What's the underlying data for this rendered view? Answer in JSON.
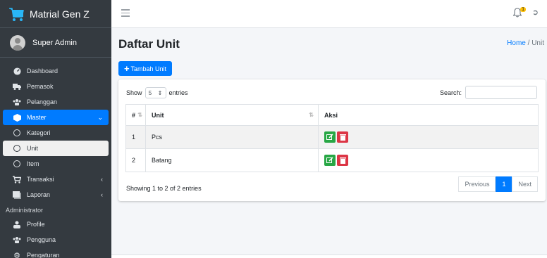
{
  "brand": {
    "name": "Matrial Gen Z"
  },
  "user": {
    "name": "Super Admin"
  },
  "sidebar": {
    "items": [
      {
        "label": "Dashboard",
        "icon": "dashboard-icon"
      },
      {
        "label": "Pemasok",
        "icon": "truck-icon"
      },
      {
        "label": "Pelanggan",
        "icon": "users-icon"
      },
      {
        "label": "Master",
        "icon": "cube-icon",
        "active": true
      },
      {
        "label": "Kategori",
        "icon": "circle-icon"
      },
      {
        "label": "Unit",
        "icon": "circle-icon",
        "selected": true
      },
      {
        "label": "Item",
        "icon": "circle-icon"
      },
      {
        "label": "Transaksi",
        "icon": "cart-icon"
      },
      {
        "label": "Laporan",
        "icon": "report-icon"
      }
    ],
    "header": "Administrator",
    "admin_items": [
      {
        "label": "Profile",
        "icon": "user-icon"
      },
      {
        "label": "Pengguna",
        "icon": "users-icon"
      },
      {
        "label": "Pengaturan",
        "icon": "gear-icon"
      }
    ]
  },
  "topbar": {
    "badge": "1"
  },
  "page": {
    "title": "Daftar Unit",
    "breadcrumb_home": "Home",
    "breadcrumb_sep": "/",
    "breadcrumb_current": "Unit",
    "add_button": "Tambah Unit"
  },
  "table": {
    "show_label": "Show",
    "entries_value": "5",
    "entries_label": "entries",
    "search_label": "Search:",
    "columns": [
      "#",
      "Unit",
      "Aksi"
    ],
    "rows": [
      {
        "no": "1",
        "unit": "Pcs"
      },
      {
        "no": "2",
        "unit": "Batang"
      }
    ],
    "info": "Showing 1 to 2 of 2 entries",
    "pager": {
      "previous": "Previous",
      "current": "1",
      "next": "Next"
    }
  },
  "colors": {
    "primary": "#007bff",
    "sidebar": "#343a40",
    "edit": "#28a745",
    "delete": "#dc3545"
  }
}
